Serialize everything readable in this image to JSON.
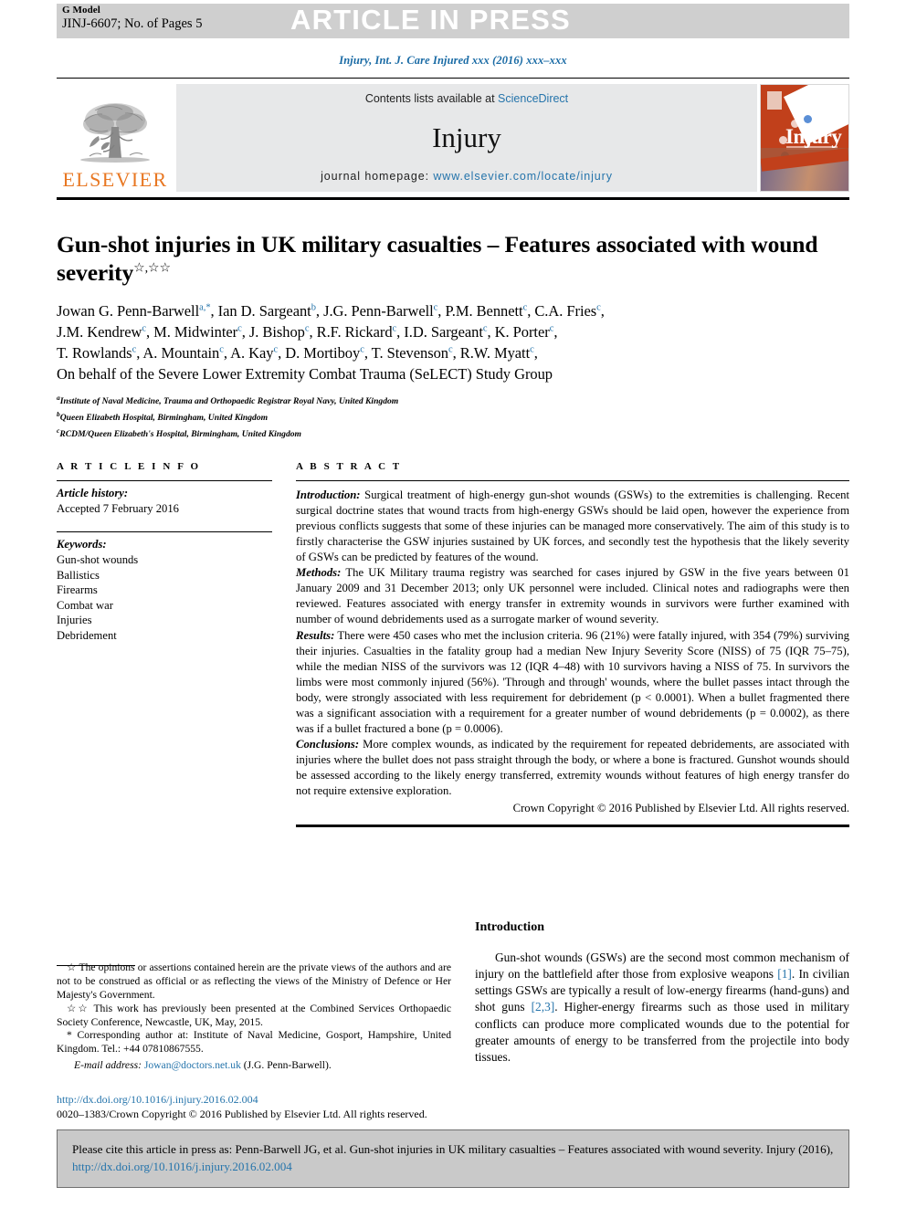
{
  "banner": {
    "g_model_label": "G Model",
    "manuscript_id": "JINJ-6607; No. of Pages 5",
    "article_in_press": "ARTICLE IN PRESS"
  },
  "journal_line": "Injury, Int. J. Care Injured xxx (2016) xxx–xxx",
  "masthead": {
    "publisher_word": "ELSEVIER",
    "contents_prefix": "Contents lists available at ",
    "contents_link": "ScienceDirect",
    "journal_title": "Injury",
    "homepage_prefix": "journal homepage: ",
    "homepage_url": "www.elsevier.com/locate/injury",
    "cover_title": "Injury"
  },
  "article": {
    "title": "Gun-shot injuries in UK military casualties – Features associated with wound severity",
    "title_footnote_marks": "☆,☆☆",
    "authors_lines": [
      "Jowan G. Penn-Barwell^a,*, Ian D. Sargeant^b, J.G. Penn-Barwell^c, P.M. Bennett^c, C.A. Fries^c,",
      "J.M. Kendrew^c, M. Midwinter^c, J. Bishop^c, R.F. Rickard^c, I.D. Sargeant^c, K. Porter^c,",
      "T. Rowlands^c, A. Mountain^c, A. Kay^c, D. Mortiboy^c, T. Stevenson^c, R.W. Myatt^c,",
      "On behalf of the Severe Lower Extremity Combat Trauma (SeLECT) Study Group"
    ],
    "affiliations": [
      {
        "mark": "a",
        "text": "Institute of Naval Medicine, Trauma and Orthopaedic Registrar Royal Navy, United Kingdom"
      },
      {
        "mark": "b",
        "text": "Queen Elizabeth Hospital, Birmingham, United Kingdom"
      },
      {
        "mark": "c",
        "text": "RCDM/Queen Elizabeth's Hospital, Birmingham, United Kingdom"
      }
    ]
  },
  "article_info": {
    "heading": "A R T I C L E  I N F O",
    "history_label": "Article history:",
    "history_value": "Accepted 7 February 2016",
    "keywords_label": "Keywords:",
    "keywords": [
      "Gun-shot wounds",
      "Ballistics",
      "Firearms",
      "Combat war",
      "Injuries",
      "Debridement"
    ]
  },
  "abstract": {
    "heading": "A B S T R A C T",
    "sections": [
      {
        "label": "Introduction:",
        "text": " Surgical treatment of high-energy gun-shot wounds (GSWs) to the extremities is challenging. Recent surgical doctrine states that wound tracts from high-energy GSWs should be laid open, however the experience from previous conflicts suggests that some of these injuries can be managed more conservatively. The aim of this study is to firstly characterise the GSW injuries sustained by UK forces, and secondly test the hypothesis that the likely severity of GSWs can be predicted by features of the wound."
      },
      {
        "label": "Methods:",
        "text": " The UK Military trauma registry was searched for cases injured by GSW in the five years between 01 January 2009 and 31 December 2013; only UK personnel were included. Clinical notes and radiographs were then reviewed. Features associated with energy transfer in extremity wounds in survivors were further examined with number of wound debridements used as a surrogate marker of wound severity."
      },
      {
        "label": "Results:",
        "text": " There were 450 cases who met the inclusion criteria. 96 (21%) were fatally injured, with 354 (79%) surviving their injuries. Casualties in the fatality group had a median New Injury Severity Score (NISS) of 75 (IQR 75–75), while the median NISS of the survivors was 12 (IQR 4–48) with 10 survivors having a NISS of 75. In survivors the limbs were most commonly injured (56%). 'Through and through' wounds, where the bullet passes intact through the body, were strongly associated with less requirement for debridement (p < 0.0001). When a bullet fragmented there was a significant association with a requirement for a greater number of wound debridements (p = 0.0002), as there was if a bullet fractured a bone (p = 0.0006)."
      },
      {
        "label": "Conclusions:",
        "text": " More complex wounds, as indicated by the requirement for repeated debridements, are associated with injuries where the bullet does not pass straight through the body, or where a bone is fractured. Gunshot wounds should be assessed according to the likely energy transferred, extremity wounds without features of high energy transfer do not require extensive exploration."
      }
    ],
    "copyright": "Crown Copyright © 2016 Published by Elsevier Ltd. All rights reserved."
  },
  "footnotes": [
    "☆ The opinions or assertions contained herein are the private views of the authors and are not to be construed as official or as reflecting the views of the Ministry of Defence or Her Majesty's Government.",
    "☆☆ This work has previously been presented at the Combined Services Orthopaedic Society Conference, Newcastle, UK, May, 2015.",
    "* Corresponding author at: Institute of Naval Medicine, Gosport, Hampshire, United Kingdom. Tel.: +44 07810867555."
  ],
  "email": {
    "label": "E-mail address:",
    "address": "Jowan@doctors.net.uk",
    "attribution": "(J.G. Penn-Barwell)."
  },
  "doi_block": {
    "doi_url": "http://dx.doi.org/10.1016/j.injury.2016.02.004",
    "issn_line": "0020–1383/Crown Copyright © 2016 Published by Elsevier Ltd. All rights reserved."
  },
  "introduction": {
    "heading": "Introduction",
    "paragraph_parts": [
      "Gun-shot wounds (GSWs) are the second most common mechanism of injury on the battlefield after those from explosive weapons ",
      "[1]",
      ". In civilian settings GSWs are typically a result of low-energy firearms (hand-guns) and shot guns ",
      "[2,3]",
      ". Higher-energy firearms such as those used in military conflicts can produce more complicated wounds due to the potential for greater amounts of energy to be transferred from the projectile into body tissues."
    ]
  },
  "cite_footer": {
    "text": "Please cite this article in press as: Penn-Barwell JG, et al. Gun-shot injuries in UK military casualties – Features associated with wound severity. Injury (2016), ",
    "doi": "http://dx.doi.org/10.1016/j.injury.2016.02.004"
  }
}
